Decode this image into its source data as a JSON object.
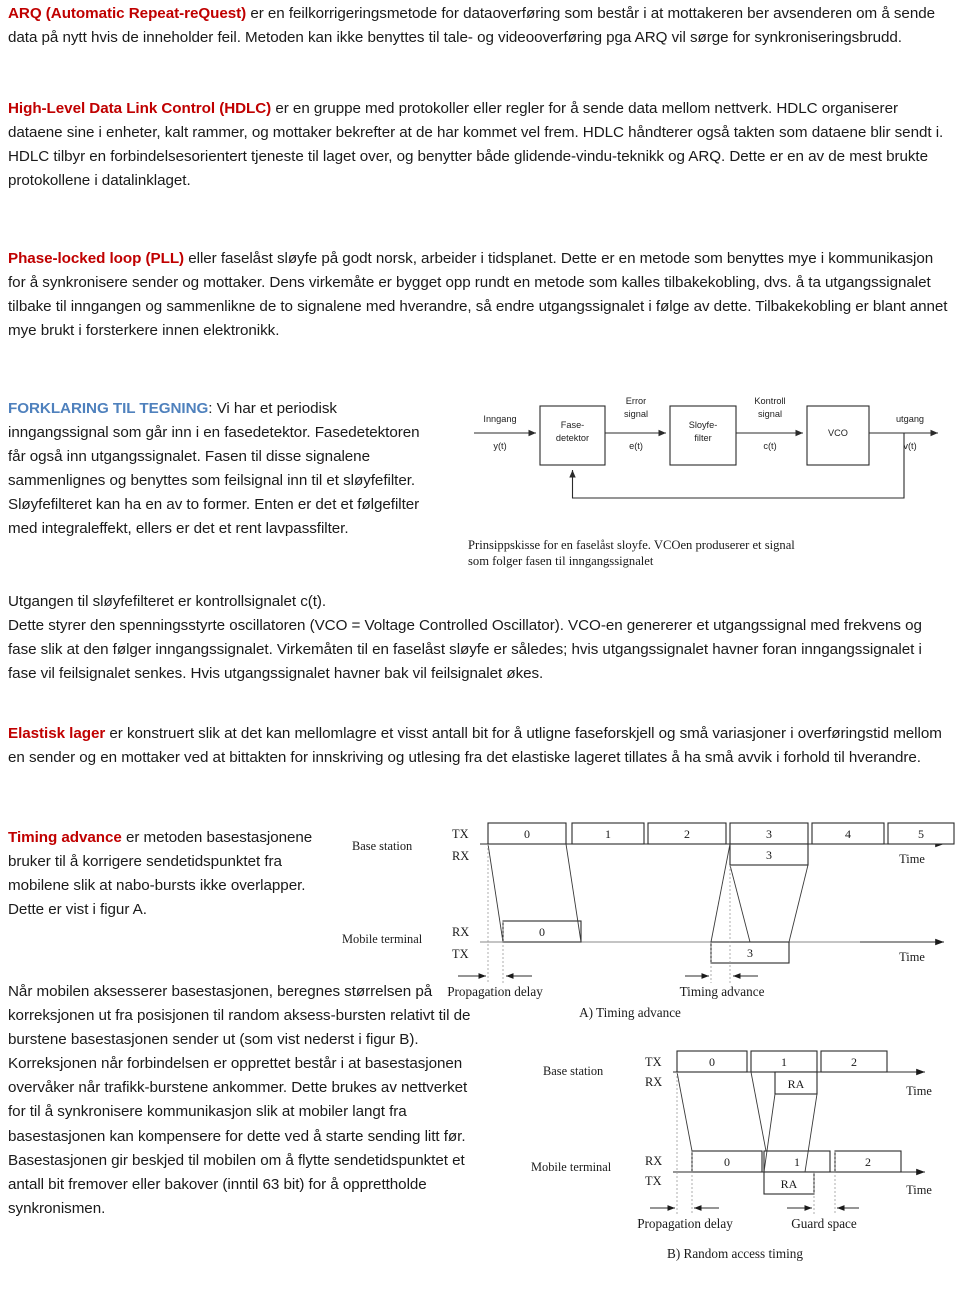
{
  "document": {
    "language": "no",
    "accent_red": "#C00000",
    "accent_blue": "#4F81BD",
    "body_color": "#1a1a1a"
  },
  "paragraphs": {
    "arq": {
      "term": "ARQ (Automatic Repeat-reQuest)",
      "body": " er en feilkorrigeringsmetode for dataoverføring som består i at mottakeren ber avsenderen om å sende data på nytt hvis de inneholder feil. Metoden kan ikke benyttes til tale- og videooverføring pga ARQ vil sørge for synkroniseringsbrudd."
    },
    "hdlc": {
      "term": "High-Level Data Link Control (HDLC)",
      "body": " er en gruppe med protokoller eller regler for å sende data mellom nettverk. HDLC organiserer dataene sine i enheter, kalt rammer, og mottaker bekrefter at de har kommet vel frem. HDLC håndterer også takten som dataene blir sendt i. HDLC tilbyr en forbindelsesorientert tjeneste til laget over, og benytter både glidende-vindu-teknikk og ARQ. Dette er en av de mest brukte protokollene i datalinklaget."
    },
    "pll": {
      "term": "Phase-locked loop (PLL)",
      "body": " eller faselåst sløyfe på godt norsk, arbeider i tidsplanet. Dette er en metode som benyttes mye i kommunikasjon for å synkronisere sender og mottaker. Dens virkemåte er bygget opp rundt en metode som kalles tilbakekobling, dvs. å ta utgangssignalet tilbake til inngangen og sammenlikne de to signalene med hverandre, så endre utgangssignalet i følge av dette. Tilbakekobling er blant annet mye brukt i forsterkere innen elektronikk."
    },
    "forklaring": {
      "term": "FORKLARING TIL TEGNING",
      "body": ": Vi har et periodisk inngangssignal som går inn i en fasedetektor. Fasedetektoren får også inn utgangssignalet. Fasen til disse signalene sammenlignes og benyttes som feilsignal inn til et sløyfefilter. Sløyfefilteret kan ha en av to former. Enten er det et følgefilter med integraleffekt, ellers er det et rent lavpassfilter."
    },
    "vco": {
      "line1": "Utgangen til sløyfefilteret er kontrollsignalet c(t).",
      "line2": "Dette styrer den spenningsstyrte oscillatoren (VCO = Voltage Controlled Oscillator).  VCO-en genererer et utgangssignal med frekvens og fase slik at den følger inngangssignalet. Virkemåten til en faselåst sløyfe er således; hvis utgangssignalet havner foran inngangssignalet i fase vil feilsignalet senkes. Hvis utgangssignalet havner bak vil feilsignalet økes."
    },
    "elastisk": {
      "term": "Elastisk lager",
      "body": " er konstruert slik at det kan mellomlagre et visst antall bit for å utligne faseforskjell og små variasjoner i overføringstid mellom en sender og en mottaker ved at bittakten for innskriving og utlesing fra det elastiske lageret tillates å ha små avvik i forhold til hverandre."
    },
    "timing_advance": {
      "term": "Timing advance",
      "body": " er metoden basestasjonene bruker til å korrigere sendetidspunktet fra mobilene slik at nabo-bursts ikke overlapper. Dette er vist i figur A."
    },
    "naar_mobilen": {
      "body": "Når mobilen aksesserer basestasjonen, beregnes størrelsen på korreksjonen ut fra posisjonen til random aksess-bursten relativt til de burstene basestasjonen sender ut (som vist nederst i figur B). Korreksjonen når forbindelsen er opprettet består i at basestasjonen overvåker når trafikk-burstene ankommer. Dette brukes av nettverket for til å synkronisere kommunikasjon slik at mobiler langt fra basestasjonen kan kompensere for dette ved å starte sending litt før. Basestasjonen gir beskjed til mobilen om å flytte sendetidspunktet et antall bit fremover eller bakover (inntil 63 bit) for å opprettholde synkronismen."
    }
  },
  "figures": {
    "pll_block_diagram": {
      "blocks": [
        {
          "name": "Fase-detektor",
          "line1": "Fase-",
          "line2": "detektor"
        },
        {
          "name": "Sloyfe-filter",
          "line1": "Sloyfe-",
          "line2": "filter"
        },
        {
          "name": "VCO",
          "line1": "VCO",
          "line2": ""
        }
      ],
      "signals": {
        "input_label": "Inngang",
        "input_var": "y(t)",
        "error_label1": "Error",
        "error_label2": "signal",
        "error_var": "e(t)",
        "control_label1": "Kontroll",
        "control_label2": "signal",
        "control_var": "c(t)",
        "output_label": "utgang",
        "output_var": "v(t)"
      },
      "caption_line1": "Prinsippskisse for en faselåst sloyfe. VCOen produserer et signal",
      "caption_line2": "som folger fasen til inngangssignalet"
    },
    "timing_advance_diagram": {
      "caption": "A) Timing advance",
      "rows": [
        {
          "entity": "Base station",
          "tx": "TX",
          "rx": "RX"
        },
        {
          "entity": "Mobile terminal",
          "rx": "RX",
          "tx": "TX"
        }
      ],
      "base_tx_bursts": [
        "0",
        "1",
        "2",
        "3",
        "4",
        "5"
      ],
      "base_rx_bursts": [
        "3"
      ],
      "mobile_rx_bursts": [
        "0"
      ],
      "mobile_tx_bursts": [
        "3"
      ],
      "axis_label": "Time",
      "annotations": [
        "Propagation delay",
        "Timing advance"
      ]
    },
    "random_access_diagram": {
      "caption": "B) Random access timing",
      "rows": [
        {
          "entity": "Base station",
          "tx": "TX",
          "rx": "RX"
        },
        {
          "entity": "Mobile terminal",
          "rx": "RX",
          "tx": "TX"
        }
      ],
      "base_tx_bursts": [
        "0",
        "1",
        "2"
      ],
      "base_rx_bursts": [
        "RA"
      ],
      "mobile_rx_bursts": [
        "0",
        "1",
        "2"
      ],
      "mobile_tx_bursts": [
        "RA"
      ],
      "axis_label": "Time",
      "annotations": [
        "Propagation delay",
        "Guard space"
      ]
    }
  }
}
